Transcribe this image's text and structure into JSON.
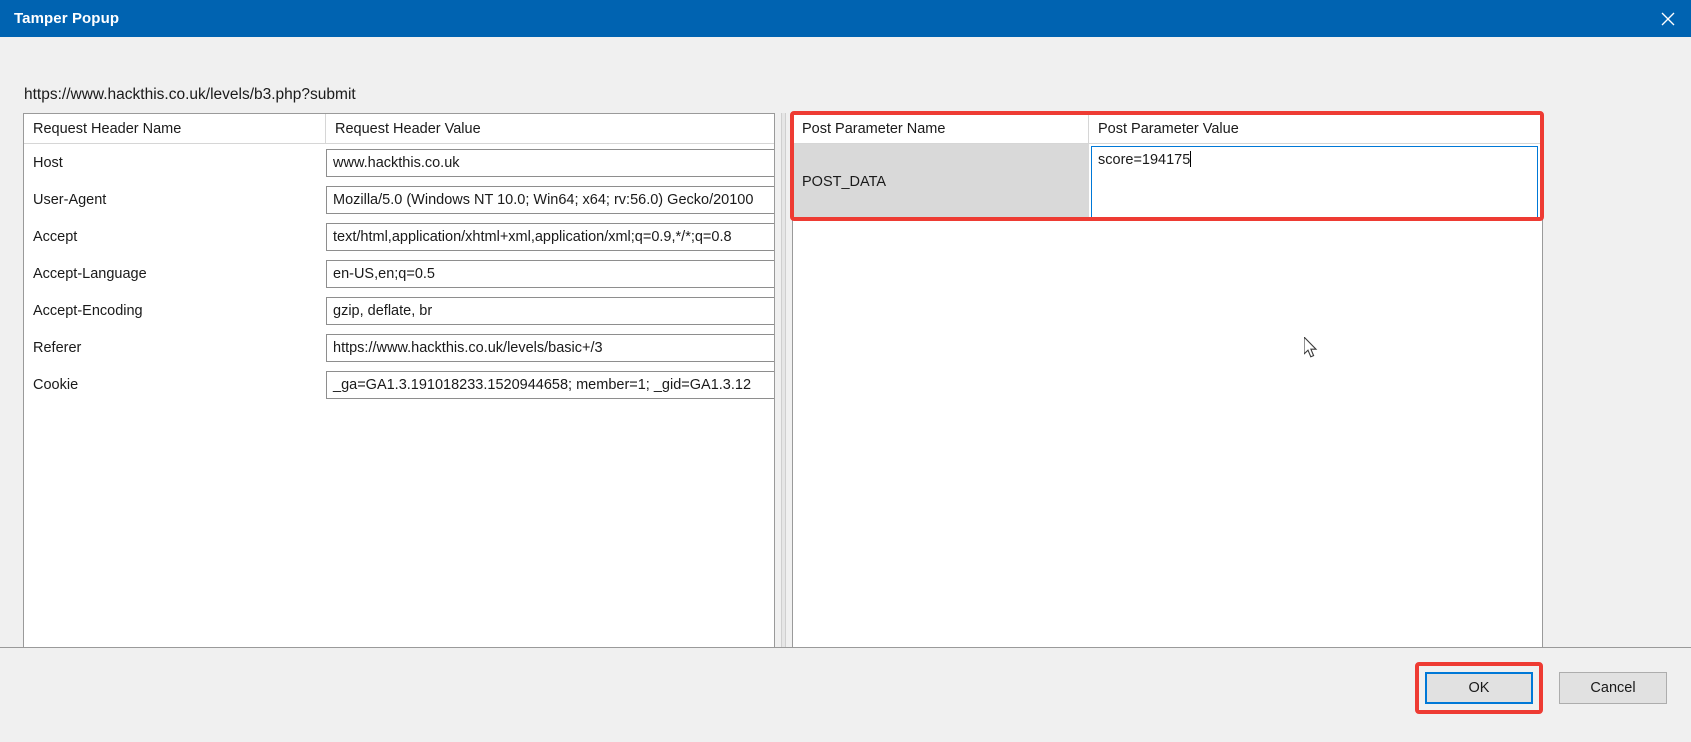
{
  "window": {
    "title": "Tamper Popup",
    "close_icon": "close-icon",
    "accent": "#0063b1",
    "highlight": "#ee3b33",
    "focus_blue": "#0078d7"
  },
  "url": "https://www.hackthis.co.uk/levels/b3.php?submit",
  "request_headers": {
    "col_name": "Request Header Name",
    "col_value": "Request Header Value",
    "rows": [
      {
        "name": "Host",
        "value": "www.hackthis.co.uk"
      },
      {
        "name": "User-Agent",
        "value": "Mozilla/5.0 (Windows NT 10.0; Win64; x64; rv:56.0) Gecko/20100"
      },
      {
        "name": "Accept",
        "value": "text/html,application/xhtml+xml,application/xml;q=0.9,*/*;q=0.8"
      },
      {
        "name": "Accept-Language",
        "value": "en-US,en;q=0.5"
      },
      {
        "name": "Accept-Encoding",
        "value": "gzip, deflate, br"
      },
      {
        "name": "Referer",
        "value": "https://www.hackthis.co.uk/levels/basic+/3"
      },
      {
        "name": "Cookie",
        "value": "_ga=GA1.3.191018233.1520944658; member=1; _gid=GA1.3.12"
      }
    ]
  },
  "post_parameters": {
    "col_name": "Post Parameter Name",
    "col_value": "Post Parameter Value",
    "rows": [
      {
        "name": "POST_DATA",
        "value": "score=194175"
      }
    ]
  },
  "footer": {
    "ok_label": "OK",
    "cancel_label": "Cancel"
  }
}
